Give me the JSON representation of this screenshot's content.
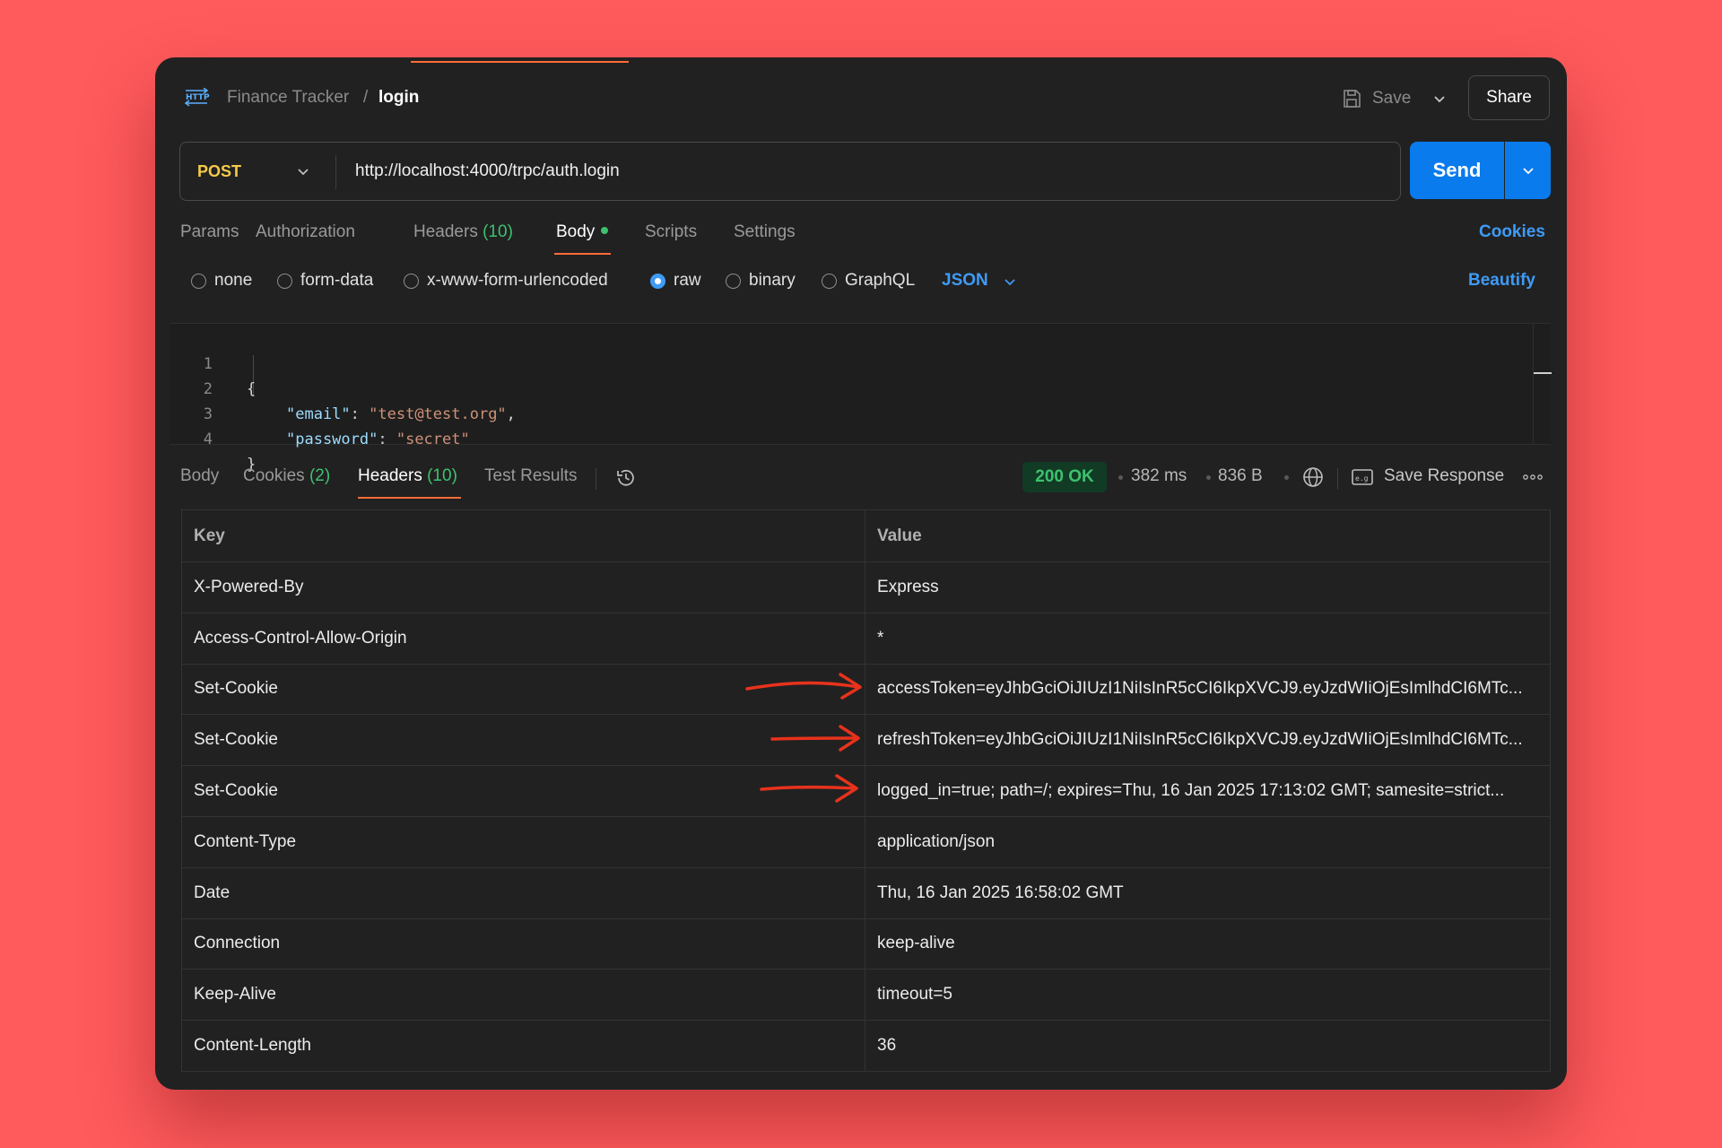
{
  "breadcrumb": {
    "collection": "Finance Tracker",
    "separator": "/",
    "request": "login"
  },
  "topbar": {
    "save_label": "Save",
    "share_label": "Share"
  },
  "request": {
    "method": "POST",
    "url": "http://localhost:4000/trpc/auth.login",
    "send_label": "Send",
    "tabs": [
      {
        "label": "Params"
      },
      {
        "label": "Authorization"
      },
      {
        "label": "Headers",
        "count": "(10)"
      },
      {
        "label": "Body"
      },
      {
        "label": "Scripts"
      },
      {
        "label": "Settings"
      }
    ],
    "active_tab": "Body",
    "cookies_label": "Cookies",
    "body_options": [
      "none",
      "form-data",
      "x-www-form-urlencoded",
      "raw",
      "binary",
      "GraphQL"
    ],
    "selected_body_option": "raw",
    "format": "JSON",
    "beautify_label": "Beautify",
    "code_lines": [
      {
        "n": "1",
        "text": "{"
      },
      {
        "n": "2",
        "key": "\"email\"",
        "colon": ": ",
        "value": "\"test@test.org\"",
        "tail": ","
      },
      {
        "n": "3",
        "key": "\"password\"",
        "colon": ": ",
        "value": "\"secret\"",
        "tail": ""
      },
      {
        "n": "4",
        "text": "}"
      }
    ]
  },
  "response": {
    "tabs": [
      {
        "label": "Body"
      },
      {
        "label": "Cookies",
        "count": "(2)"
      },
      {
        "label": "Headers",
        "count": "(10)"
      },
      {
        "label": "Test Results"
      }
    ],
    "active_tab": "Headers",
    "status": "200 OK",
    "time": "382 ms",
    "size": "836 B",
    "save_response_label": "Save Response",
    "table": {
      "columns": [
        "Key",
        "Value"
      ],
      "rows": [
        {
          "key": "X-Powered-By",
          "value": "Express"
        },
        {
          "key": "Access-Control-Allow-Origin",
          "value": "*"
        },
        {
          "key": "Set-Cookie",
          "value": "accessToken=eyJhbGciOiJIUzI1NiIsInR5cCI6IkpXVCJ9.eyJzdWIiOjEsImlhdCI6MTc..."
        },
        {
          "key": "Set-Cookie",
          "value": "refreshToken=eyJhbGciOiJIUzI1NiIsInR5cCI6IkpXVCJ9.eyJzdWIiOjEsImlhdCI6MTc..."
        },
        {
          "key": "Set-Cookie",
          "value": "logged_in=true; path=/; expires=Thu, 16 Jan 2025 17:13:02 GMT; samesite=strict..."
        },
        {
          "key": "Content-Type",
          "value": "application/json"
        },
        {
          "key": "Date",
          "value": "Thu, 16 Jan 2025 16:58:02 GMT"
        },
        {
          "key": "Connection",
          "value": "keep-alive"
        },
        {
          "key": "Keep-Alive",
          "value": "timeout=5"
        },
        {
          "key": "Content-Length",
          "value": "36"
        }
      ]
    }
  },
  "colors": {
    "accent": "#ff6c37",
    "primary": "#097bed",
    "success": "#3ec16f",
    "background": "#ff5a5c",
    "annotation": "#e8321c"
  }
}
